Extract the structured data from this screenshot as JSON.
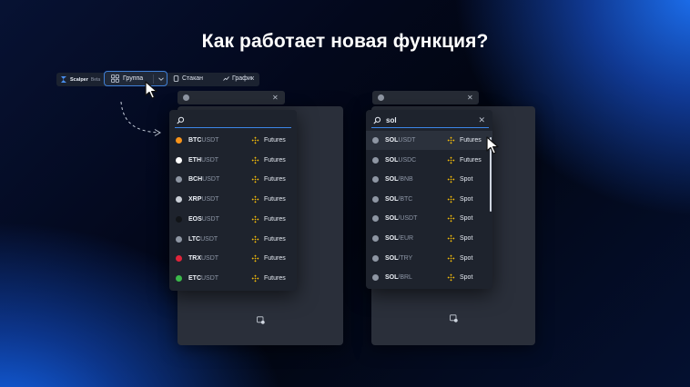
{
  "headline": "Как работает новая функция?",
  "toolbar": {
    "brand": "Scalper",
    "brand_tag": "Beta",
    "group_label": "Группа",
    "stakan_label": "Стакан",
    "chart_label": "График"
  },
  "left_dropdown": {
    "search_value": "",
    "rows": [
      {
        "base": "BTC",
        "quote": "USDT",
        "market": "Futures",
        "coin_color": "#f7931a"
      },
      {
        "base": "ETH",
        "quote": "USDT",
        "market": "Futures",
        "coin_color": "#ffffff"
      },
      {
        "base": "BCH",
        "quote": "USDT",
        "market": "Futures",
        "coin_color": "#8e96a3"
      },
      {
        "base": "XRP",
        "quote": "USDT",
        "market": "Futures",
        "coin_color": "#c9ced6"
      },
      {
        "base": "EOS",
        "quote": "USDT",
        "market": "Futures",
        "coin_color": "#111418"
      },
      {
        "base": "LTC",
        "quote": "USDT",
        "market": "Futures",
        "coin_color": "#8e96a3"
      },
      {
        "base": "TRX",
        "quote": "USDT",
        "market": "Futures",
        "coin_color": "#e0243a"
      },
      {
        "base": "ETC",
        "quote": "USDT",
        "market": "Futures",
        "coin_color": "#3bb94a"
      }
    ]
  },
  "right_dropdown": {
    "search_value": "sol",
    "clear_glyph": "✕",
    "rows": [
      {
        "base": "SOL",
        "quote": "USDT",
        "market": "Futures",
        "coin_color": "#8e96a3"
      },
      {
        "base": "SOL",
        "quote": "USDC",
        "market": "Futures",
        "coin_color": "#8e96a3"
      },
      {
        "base": "SOL",
        "quote": "/BNB",
        "market": "Spot",
        "coin_color": "#8e96a3"
      },
      {
        "base": "SOL",
        "quote": "/BTC",
        "market": "Spot",
        "coin_color": "#8e96a3"
      },
      {
        "base": "SOL",
        "quote": "/USDT",
        "market": "Spot",
        "coin_color": "#8e96a3"
      },
      {
        "base": "SOL",
        "quote": "/EUR",
        "market": "Spot",
        "coin_color": "#8e96a3"
      },
      {
        "base": "SOL",
        "quote": "/TRY",
        "market": "Spot",
        "coin_color": "#8e96a3"
      },
      {
        "base": "SOL",
        "quote": "/BRL",
        "market": "Spot",
        "coin_color": "#8e96a3"
      }
    ]
  },
  "window_close_glyph": "✕",
  "colors": {
    "accent": "#3c86e8",
    "binance": "#f0b90b"
  },
  "icons": [
    "scalper-logo-icon",
    "grid-icon",
    "chevron-down-icon",
    "order-book-icon",
    "chart-icon",
    "search-icon",
    "close-icon",
    "binance-icon",
    "add-window-icon",
    "cursor-icon"
  ]
}
